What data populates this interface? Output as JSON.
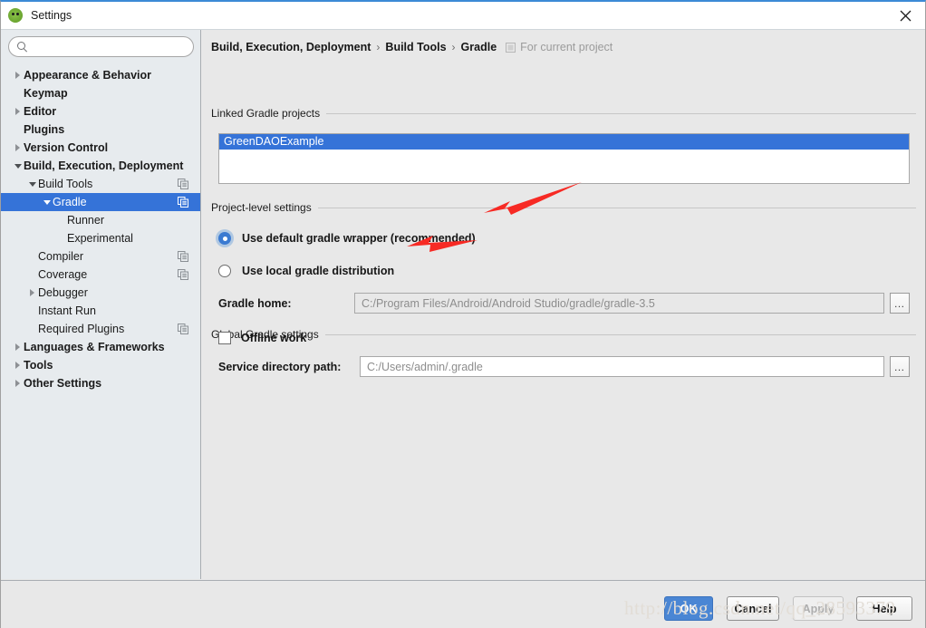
{
  "window": {
    "title": "Settings",
    "app_icon": "android-studio-icon",
    "close_label": "✕"
  },
  "sidebar": {
    "search": {
      "value": "",
      "placeholder": "",
      "icon": "search-icon"
    },
    "items": [
      {
        "label": "Appearance & Behavior",
        "indent": 0,
        "twisty": "collapsed",
        "bold": true,
        "copy_icon": false,
        "selected": false
      },
      {
        "label": "Keymap",
        "indent": 0,
        "twisty": "none",
        "bold": true,
        "copy_icon": false,
        "selected": false
      },
      {
        "label": "Editor",
        "indent": 0,
        "twisty": "collapsed",
        "bold": true,
        "copy_icon": false,
        "selected": false
      },
      {
        "label": "Plugins",
        "indent": 0,
        "twisty": "none",
        "bold": true,
        "copy_icon": false,
        "selected": false
      },
      {
        "label": "Version Control",
        "indent": 0,
        "twisty": "collapsed",
        "bold": true,
        "copy_icon": false,
        "selected": false
      },
      {
        "label": "Build, Execution, Deployment",
        "indent": 0,
        "twisty": "expanded",
        "bold": true,
        "copy_icon": false,
        "selected": false
      },
      {
        "label": "Build Tools",
        "indent": 1,
        "twisty": "expanded",
        "bold": false,
        "copy_icon": true,
        "selected": false
      },
      {
        "label": "Gradle",
        "indent": 2,
        "twisty": "expanded",
        "bold": false,
        "copy_icon": true,
        "selected": true
      },
      {
        "label": "Runner",
        "indent": 3,
        "twisty": "none",
        "bold": false,
        "copy_icon": false,
        "selected": false
      },
      {
        "label": "Experimental",
        "indent": 3,
        "twisty": "none",
        "bold": false,
        "copy_icon": false,
        "selected": false
      },
      {
        "label": "Compiler",
        "indent": 1,
        "twisty": "none",
        "bold": false,
        "copy_icon": true,
        "selected": false
      },
      {
        "label": "Coverage",
        "indent": 1,
        "twisty": "none",
        "bold": false,
        "copy_icon": true,
        "selected": false
      },
      {
        "label": "Debugger",
        "indent": 1,
        "twisty": "collapsed",
        "bold": false,
        "copy_icon": false,
        "selected": false
      },
      {
        "label": "Instant Run",
        "indent": 1,
        "twisty": "none",
        "bold": false,
        "copy_icon": false,
        "selected": false
      },
      {
        "label": "Required Plugins",
        "indent": 1,
        "twisty": "none",
        "bold": false,
        "copy_icon": true,
        "selected": false
      },
      {
        "label": "Languages & Frameworks",
        "indent": 0,
        "twisty": "collapsed",
        "bold": true,
        "copy_icon": false,
        "selected": false
      },
      {
        "label": "Tools",
        "indent": 0,
        "twisty": "collapsed",
        "bold": true,
        "copy_icon": false,
        "selected": false
      },
      {
        "label": "Other Settings",
        "indent": 0,
        "twisty": "collapsed",
        "bold": true,
        "copy_icon": false,
        "selected": false
      }
    ]
  },
  "breadcrumb": {
    "crumb1": "Build, Execution, Deployment",
    "crumb2": "Build Tools",
    "crumb3": "Gradle",
    "separator": "›",
    "note": "For current project",
    "note_icon": "project-scope-icon"
  },
  "main": {
    "linked_projects": {
      "group_label": "Linked Gradle projects",
      "items": [
        {
          "label": "GreenDAOExample",
          "selected": true
        }
      ]
    },
    "project_level": {
      "group_label": "Project-level settings",
      "radio_default_wrapper": {
        "label": "Use default gradle wrapper (recommended)",
        "checked": true
      },
      "radio_local_distribution": {
        "label": "Use local gradle distribution",
        "checked": false
      },
      "gradle_home": {
        "label": "Gradle home:",
        "value": "C:/Program Files/Android/Android Studio/gradle/gradle-3.5",
        "browse_label": "…",
        "disabled": true
      }
    },
    "global_settings": {
      "group_label": "Global Gradle settings",
      "offline_work": {
        "label": "Offline work",
        "checked": false
      },
      "service_directory": {
        "label": "Service directory path:",
        "value": "C:/Users/admin/.gradle",
        "browse_label": "…"
      }
    }
  },
  "footer": {
    "buttons": [
      {
        "label": "OK",
        "style": "primary"
      },
      {
        "label": "Cancel",
        "style": "normal"
      },
      {
        "label": "Apply",
        "style": "disabled"
      },
      {
        "label": "Help",
        "style": "normal"
      }
    ],
    "watermark": "http://blog.csdn.net/qq_28593379"
  },
  "annotations": {
    "arrow_color": "#f72a24",
    "arrow1_target": "Use default gradle wrapper (recommended)",
    "arrow2_target": "Use local gradle distribution"
  },
  "colors": {
    "accent": "#3573d8",
    "primary_button": "#4a86d4",
    "sidebar_bg": "#e7ebee",
    "main_bg": "#e8e8e8",
    "arrow_red": "#f72a24"
  }
}
